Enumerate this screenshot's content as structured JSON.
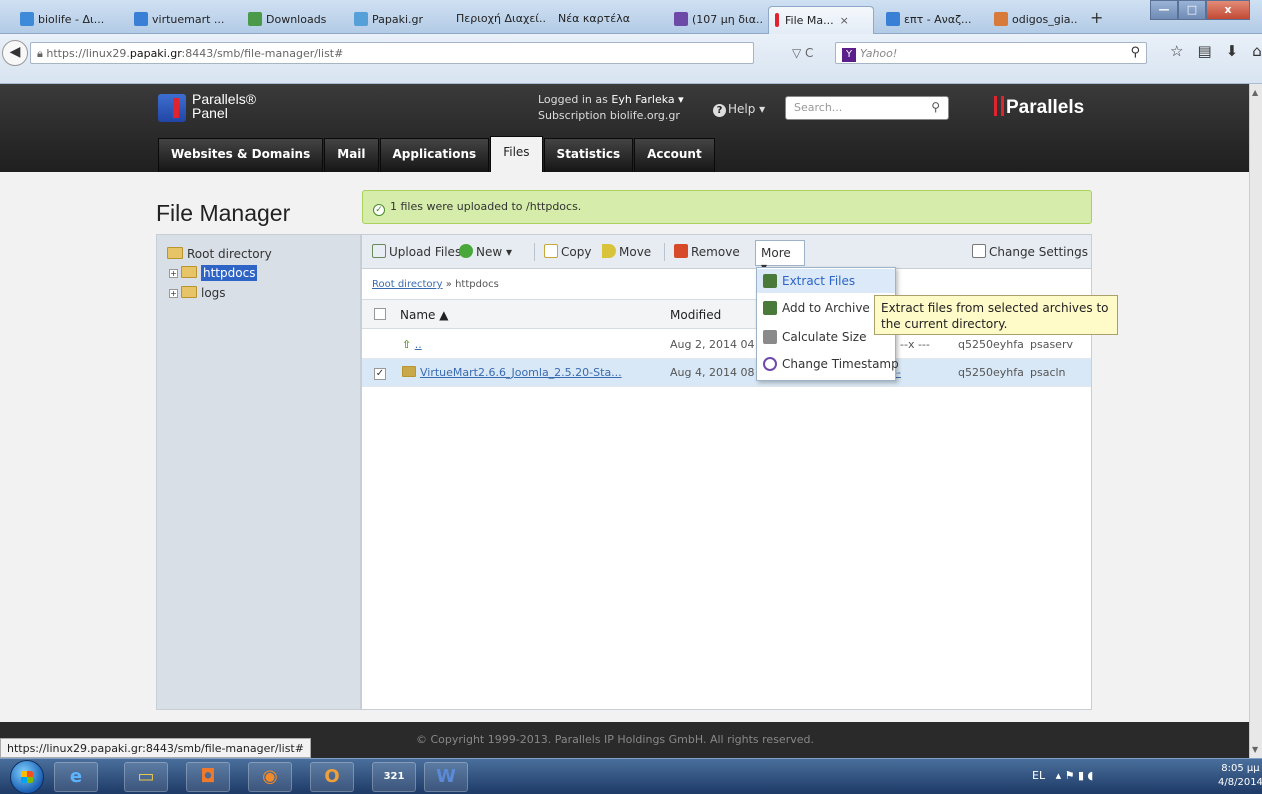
{
  "browser": {
    "tabs": [
      {
        "label": "biolife - Δι...",
        "icon_color": "#3d8ad8"
      },
      {
        "label": "virtuemart ...",
        "icon_color": "#3a7fd6"
      },
      {
        "label": "Downloads",
        "icon_color": "#4a9a4a"
      },
      {
        "label": "Papaki.gr",
        "icon_color": "#55a0d8"
      },
      {
        "label": "Περιοχή Διαχεί...",
        "icon_color": ""
      },
      {
        "label": "Νέα καρτέλα",
        "icon_color": ""
      },
      {
        "label": "(107 μη δια...",
        "icon_color": "#6d4aa8"
      },
      {
        "label": "File Ma...",
        "icon_color": "#e0232e",
        "close": "×"
      },
      {
        "label": "επτ - Αναζ...",
        "icon_color": "#3a7fd6"
      },
      {
        "label": "odigos_gia...",
        "icon_color": "#d87a3a"
      }
    ],
    "new_tab": "+",
    "window_buttons": {
      "minimize": "—",
      "maximize": "□",
      "close": "x"
    },
    "back": "◀",
    "url_prefix": "https://linux29.",
    "url_domain": "papaki.gr",
    "url_suffix": ":8443/smb/file-manager/list#",
    "url_actions": "▽ C",
    "search_engine": "Y",
    "search_placeholder": "Yahoo!",
    "search_icon": "⚲",
    "nav_icons": [
      "☆",
      "▤",
      "⬇",
      "⌂",
      "≡"
    ]
  },
  "panel": {
    "logo_line1": "Parallels®",
    "logo_line2": "Panel",
    "logged_in": "Logged in as",
    "user": "Eyh Farleka ▾",
    "subscription": "Subscription biolife.org.gr",
    "help": "Help ▾",
    "search_placeholder": "Search...",
    "brand": "Parallels",
    "tabs": [
      "Websites & Domains",
      "Mail",
      "Applications",
      "Files",
      "Statistics",
      "Account"
    ],
    "active_tab": "Files"
  },
  "page": {
    "title": "File Manager",
    "message": "1 files were uploaded to /httpdocs."
  },
  "tree": {
    "root": "Root directory",
    "items": [
      "httpdocs",
      "logs"
    ],
    "selected": "httpdocs"
  },
  "toolbar": {
    "upload": "Upload Files",
    "new": "New ▾",
    "copy": "Copy",
    "move": "Move",
    "remove": "Remove",
    "more": "More ▾",
    "change_settings": "Change Settings"
  },
  "breadcrumb": {
    "root": "Root directory",
    "sep": "»",
    "current": "httpdocs"
  },
  "table": {
    "headers": {
      "name": "Name ▲",
      "modified": "Modified"
    },
    "rows": [
      {
        "name": "..",
        "modified": "Aug 2, 2014 04",
        "perms": "--x ---",
        "owner": "q5250eyhfa",
        "group": "psaserv",
        "checked": false
      },
      {
        "name": "VirtueMart2.6.6_Joomla_2.5.20-Sta...",
        "modified": "Aug 4, 2014 08",
        "perms": "r-- r--",
        "owner": "q5250eyhfa",
        "group": "psacln",
        "checked": true
      }
    ]
  },
  "more_menu": {
    "items": [
      "Extract Files",
      "Add to Archive",
      "Calculate Size",
      "Change Timestamp"
    ],
    "hovered": "Extract Files"
  },
  "tooltip": {
    "line1": "Extract files from selected archives to",
    "line2": "the current directory."
  },
  "footer": {
    "copyright": "© Copyright 1999-2013. Parallels IP Holdings GmbH. All rights reserved."
  },
  "status_url": "https://linux29.papaki.gr:8443/smb/file-manager/list#",
  "taskbar": {
    "apps": [
      "e",
      "▭",
      "◘",
      "◉",
      "O",
      "321",
      "W"
    ],
    "tray_lang": "EL",
    "tray_icons": "▴ ⚑ ▮ ◖",
    "time": "8:05 μμ",
    "date": "4/8/2014"
  },
  "colors": {
    "accent": "#2e64c5",
    "success_bg": "#d5ecaa",
    "brand_red": "#e0232e"
  }
}
